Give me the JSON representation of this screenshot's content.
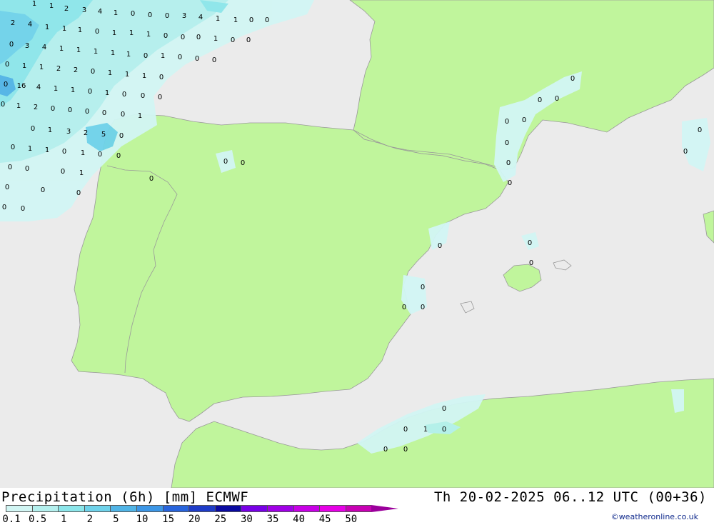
{
  "title_left": "Precipitation (6h) [mm] ECMWF",
  "title_right": "Th 20-02-2025 06..12 UTC (00+36)",
  "credit": "©weatheronline.co.uk",
  "legend": {
    "ticks": [
      "0.1",
      "0.5",
      "1",
      "2",
      "5",
      "10",
      "15",
      "20",
      "25",
      "30",
      "35",
      "40",
      "45",
      "50"
    ],
    "colors": [
      "#d2f6f4",
      "#b4f0ee",
      "#8ce6ea",
      "#6ed2ea",
      "#50b4e6",
      "#3c96e6",
      "#2864dc",
      "#1e3cc8",
      "#0a0aa0",
      "#7800e6",
      "#a000e6",
      "#c800e6",
      "#e600e6",
      "#c800b4"
    ]
  },
  "colors": {
    "sea": "#ebebeb",
    "land": "#c0f59c",
    "precip_light": "#d2f6f4",
    "precip_mid": "#8ce6ea",
    "precip_high": "#50b4e6"
  },
  "precip_labels": [
    "1",
    "1",
    "2",
    "3",
    "4",
    "1",
    "0",
    "0",
    "0",
    "3",
    "4",
    "1",
    "1",
    "0",
    "0",
    "2",
    "4",
    "1",
    "1",
    "1",
    "0",
    "1",
    "1",
    "1",
    "0",
    "0",
    "0",
    "1",
    "0",
    "0",
    "0",
    "3",
    "4",
    "1",
    "1",
    "1",
    "1",
    "1",
    "0",
    "1",
    "0",
    "0",
    "0",
    "0",
    "1",
    "1",
    "2",
    "2",
    "0",
    "1",
    "1",
    "1",
    "0",
    "0",
    "16",
    "4",
    "1",
    "1",
    "0",
    "1",
    "0",
    "0",
    "0",
    "0",
    "1",
    "2",
    "0",
    "0",
    "0",
    "0",
    "0",
    "1",
    "0",
    "1",
    "3",
    "2",
    "5",
    "0",
    "0",
    "1",
    "1",
    "0",
    "1",
    "0",
    "0",
    "0",
    "0",
    "0",
    "1",
    "0",
    "0",
    "0",
    "0",
    "0",
    "0",
    "0",
    "0",
    "0",
    "0",
    "0",
    "0",
    "0",
    "0",
    "0",
    "0",
    "0",
    "0",
    "0",
    "0",
    "0",
    "0",
    "0",
    "0",
    "0",
    "0",
    "1",
    "0",
    "0",
    "0"
  ]
}
